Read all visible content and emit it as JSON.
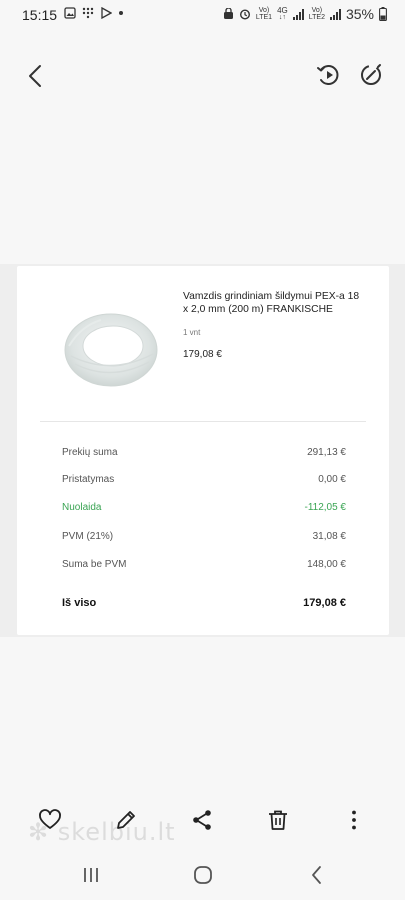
{
  "status_bar": {
    "time": "15:15",
    "net1_top": "Vo)",
    "net1_bottom": "LTE1",
    "net_type": "4G",
    "net2_top": "Vo)",
    "net2_bottom": "LTE2",
    "battery": "35%"
  },
  "product": {
    "title": "Vamzdis grindiniam šildymui PEX-a 18 x 2,0 mm (200 m) FRANKISCHE",
    "quantity": "1 vnt",
    "price": "179,08 €"
  },
  "summary": {
    "rows": [
      {
        "label": "Prekių suma",
        "value": "291,13 €"
      },
      {
        "label": "Pristatymas",
        "value": "0,00 €"
      },
      {
        "label": "Nuolaida",
        "value": "-112,05 €"
      },
      {
        "label": "PVM (21%)",
        "value": "31,08 €"
      },
      {
        "label": "Suma be PVM",
        "value": "148,00 €"
      }
    ],
    "total_label": "Iš viso",
    "total_value": "179,08 €"
  },
  "watermark": "skelbiu.lt",
  "colors": {
    "discount": "#3aa453",
    "background": "#f7f7f7",
    "card": "#ffffff"
  }
}
